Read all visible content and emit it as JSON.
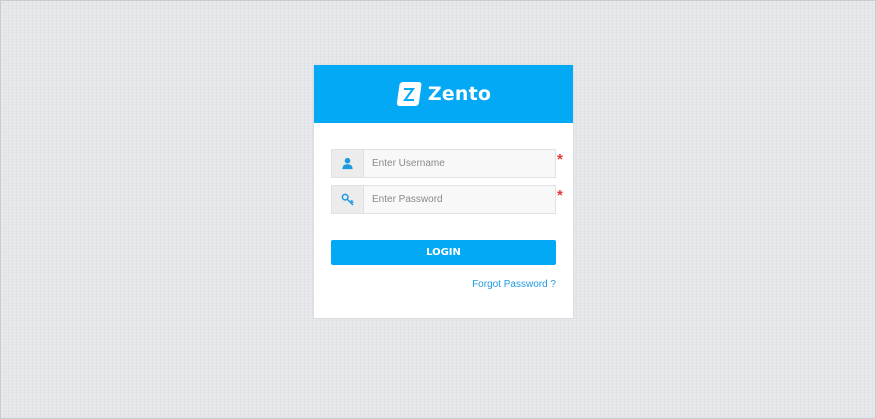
{
  "brand": {
    "logo_icon": "z-logo-icon",
    "name": "Zento",
    "color": "#03a9f4"
  },
  "form": {
    "username": {
      "icon": "user-icon",
      "placeholder": "Enter Username",
      "value": "",
      "required_marker": "*"
    },
    "password": {
      "icon": "key-icon",
      "placeholder": "Enter Password",
      "value": "",
      "required_marker": "*"
    },
    "login_label": "LOGIN",
    "forgot_label": "Forgot Password ?"
  },
  "colors": {
    "accent": "#03a9f4",
    "required": "#e53935",
    "link": "#1e9be0",
    "background": "#e4e6e9"
  }
}
